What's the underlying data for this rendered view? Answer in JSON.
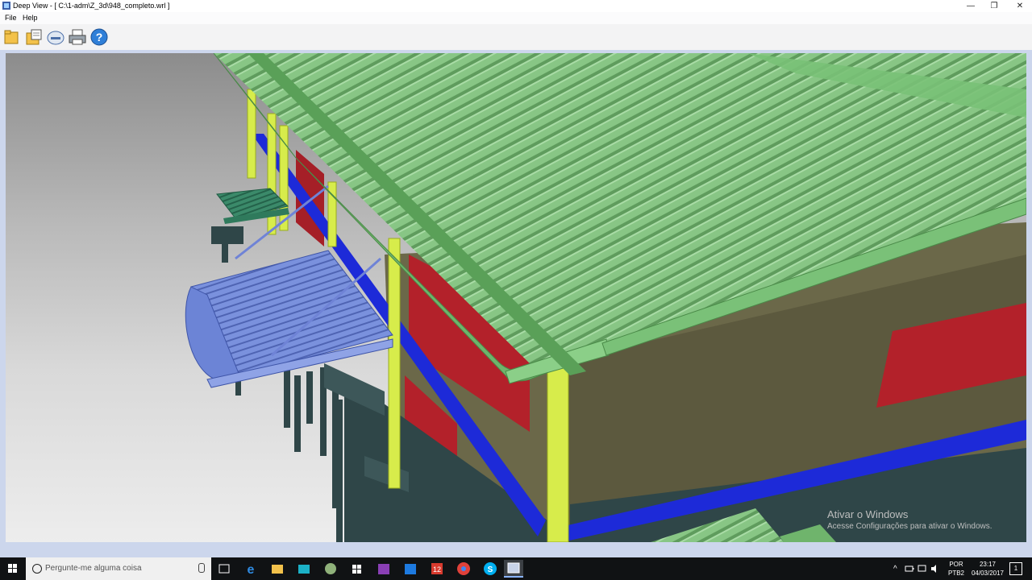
{
  "window": {
    "title": "Deep View - [ C:\\1-adm\\Z_3d\\948_completo.wrl ]",
    "minimize": "—",
    "maximize": "❐",
    "close": "✕"
  },
  "menu": {
    "items": [
      "File",
      "Help"
    ]
  },
  "toolbar": {
    "buttons": [
      "open-folder-icon",
      "open-files-icon",
      "scanner-icon",
      "printer-icon",
      "help-icon"
    ]
  },
  "watermark": {
    "title": "Ativar o Windows",
    "subtitle": "Acesse Configurações para ativar o Windows."
  },
  "taskbar": {
    "search_placeholder": "Pergunte-me alguma coisa",
    "apps": [
      "task-view",
      "edge",
      "file-explorer",
      "store",
      "app",
      "windows-store",
      "onenote",
      "outlook",
      "app-12",
      "chrome",
      "skype",
      "deep-view"
    ],
    "tray_chevron": "^",
    "lang_line1": "POR",
    "lang_line2": "PTB2",
    "time": "23:17",
    "date": "04/03/2017",
    "notification_count": "1"
  },
  "colors": {
    "roof_green": "#7cc07a",
    "awning_blue": "#7087d4",
    "beam_yellow": "#d4e84a",
    "wall_red": "#b4232a",
    "wall_olive": "#6e6a4a",
    "rail_blue": "#1d2ad8",
    "column_teal": "#2f4648"
  }
}
